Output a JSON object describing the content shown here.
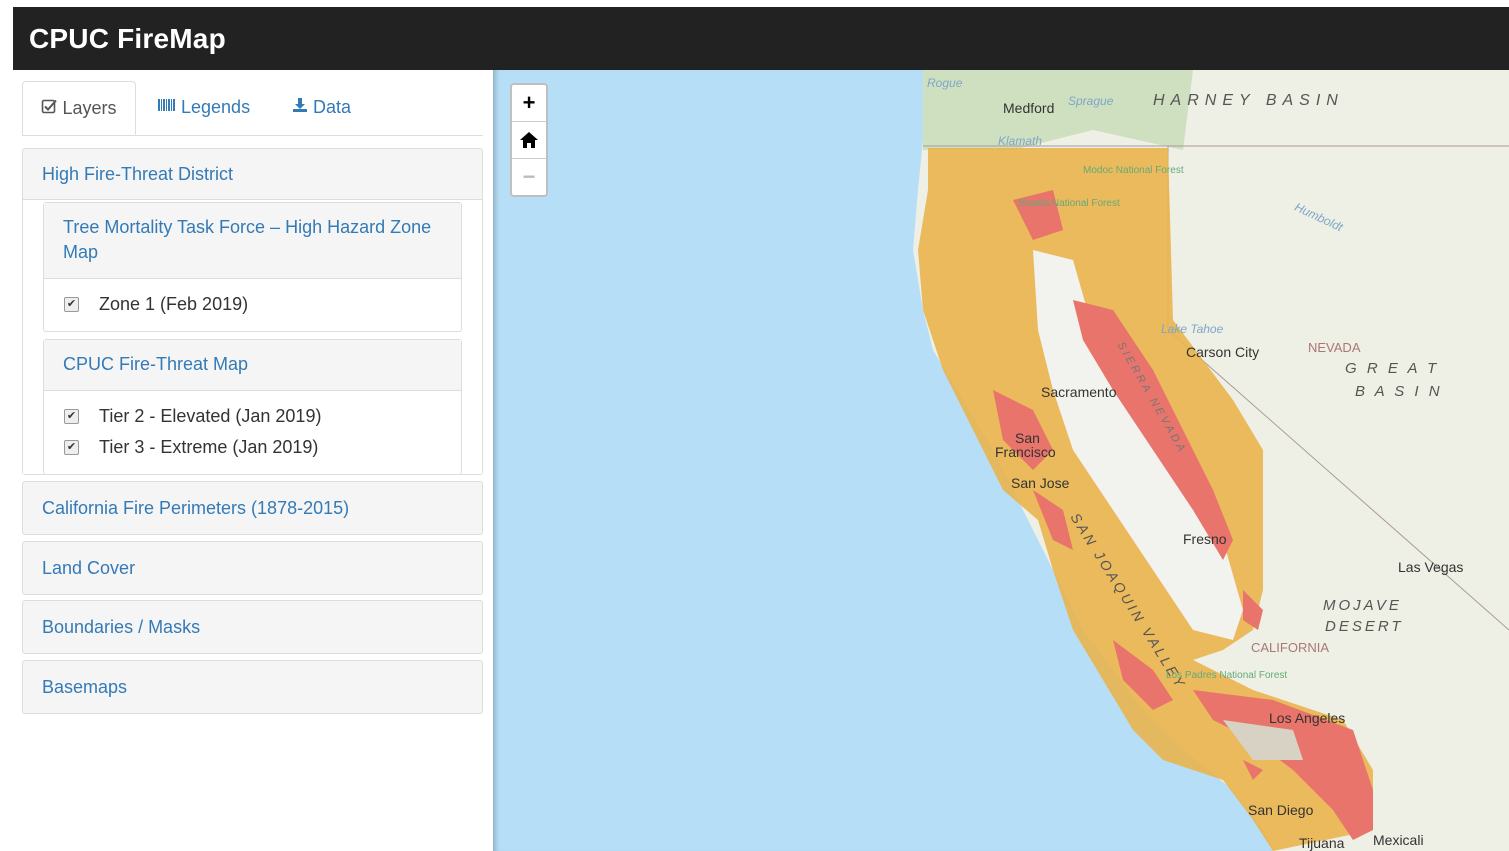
{
  "app": {
    "title": "CPUC FireMap"
  },
  "tabs": [
    {
      "label": "Layers",
      "icon": "check-square-icon",
      "active": true
    },
    {
      "label": "Legends",
      "icon": "barcode-icon",
      "active": false
    },
    {
      "label": "Data",
      "icon": "download-icon",
      "active": false
    }
  ],
  "panels": {
    "high_fire": {
      "title": "High Fire-Threat District",
      "tree_mortality": {
        "title": "Tree Mortality Task Force – High Hazard Zone Map",
        "items": [
          {
            "label": "Zone 1 (Feb 2019)",
            "checked": true
          }
        ]
      },
      "fire_threat": {
        "title": "CPUC Fire-Threat Map",
        "items": [
          {
            "label": "Tier 2 - Elevated (Jan 2019)",
            "checked": true
          },
          {
            "label": "Tier 3 - Extreme (Jan 2019)",
            "checked": true
          }
        ]
      }
    },
    "collapsed": [
      "California Fire Perimeters (1878-2015)",
      "Land Cover",
      "Boundaries / Masks",
      "Basemaps"
    ]
  },
  "map": {
    "controls": {
      "zoom_in": "+",
      "zoom_out": "−"
    },
    "colors": {
      "ocean": "#b6dff7",
      "land": "#eef0e6",
      "tier2": "#e9b44c",
      "tier3": "#e8746b",
      "forest": "#cfe0c0"
    },
    "labels": {
      "medford": "Medford",
      "harney": "HARNEY BASIN",
      "carson": "Carson City",
      "nevada": "NEVADA",
      "great": "G R E A T",
      "basin": "B A S I N",
      "sacramento": "Sacramento",
      "san_francisco_1": "San",
      "san_francisco_2": "Francisco",
      "san_jose": "San Jose",
      "san_joaquin": "SAN JOAQUIN VALLEY",
      "fresno": "Fresno",
      "las_vegas": "Las Vegas",
      "mojave": "MOJAVE",
      "desert": "DESERT",
      "california": "CALIFORNIA",
      "los_angeles": "Los Angeles",
      "san_diego": "San Diego",
      "tijuana": "Tijuana",
      "mexicali": "Mexicali",
      "modoc": "Modoc National Forest",
      "shasta": "Shasta National Forest",
      "los_padres": "Los Padres National Forest",
      "humboldt": "Humboldt",
      "sprague": "Sprague",
      "rogue": "Rogue",
      "klamath": "Klamath",
      "sierra": "SIERRA NEVADA",
      "tahoe": "Lake Tahoe"
    }
  }
}
